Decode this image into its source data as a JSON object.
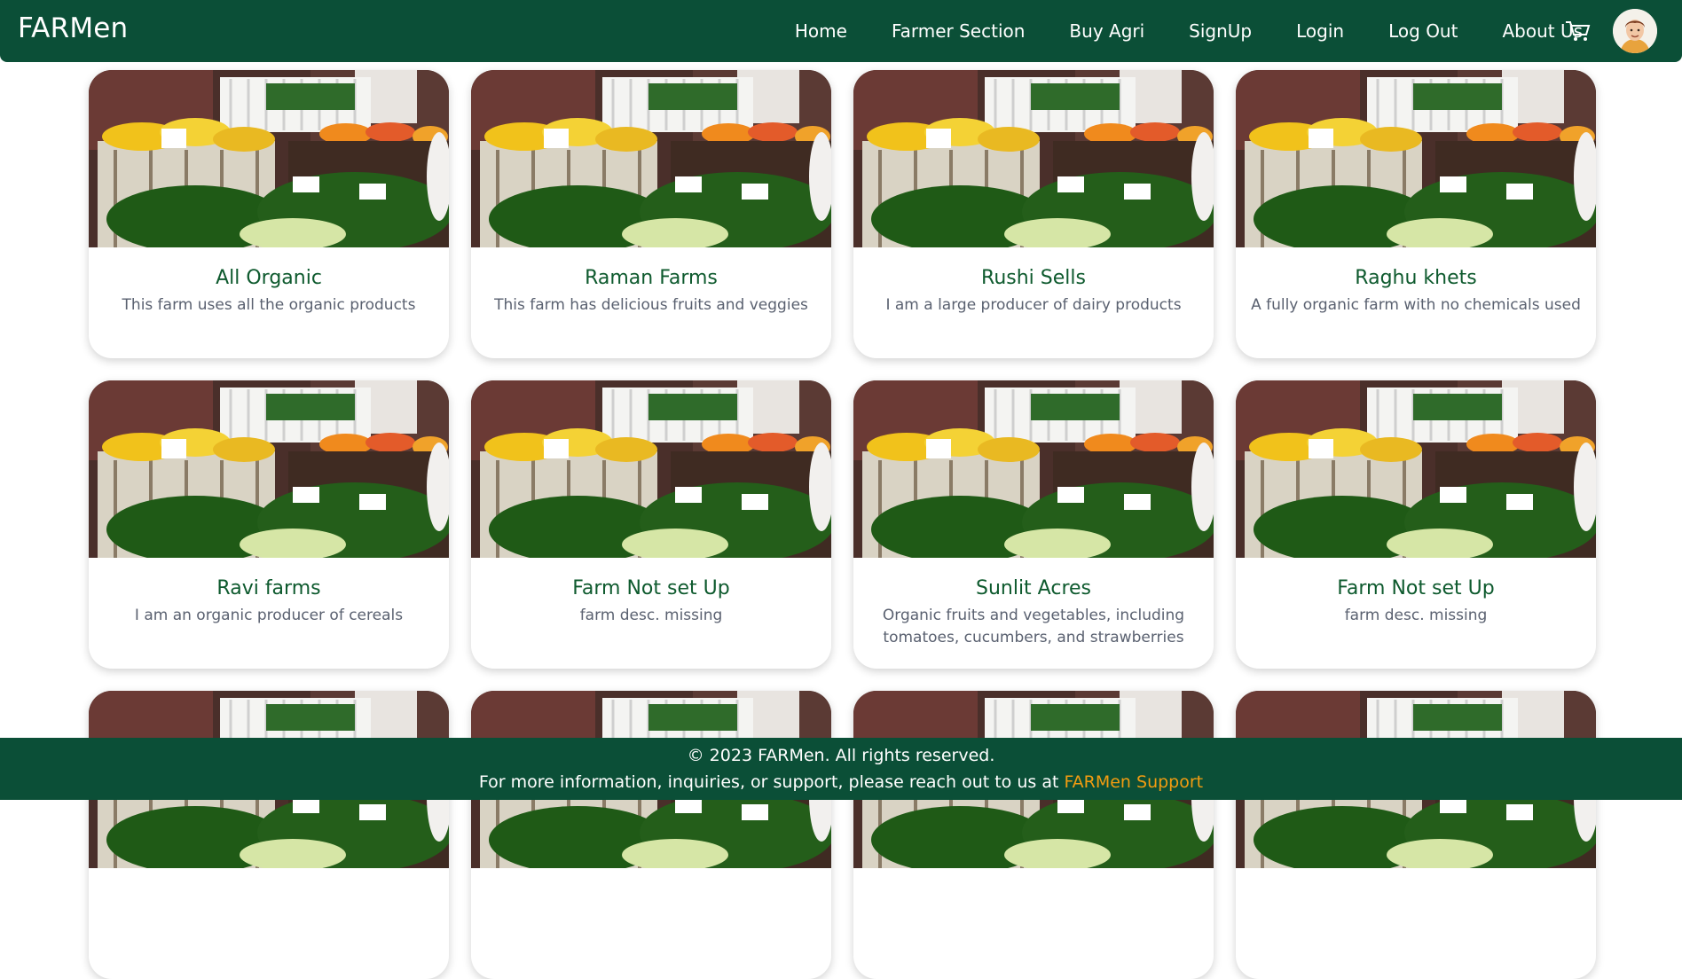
{
  "navbar": {
    "brand": "FARMen",
    "links": [
      "Home",
      "Farmer Section",
      "Buy Agri",
      "SignUp",
      "Login",
      "Log Out",
      "About Us"
    ]
  },
  "farms": [
    {
      "title": "All Organic",
      "desc": "This farm uses all the organic products"
    },
    {
      "title": "Raman Farms",
      "desc": "This farm has delicious fruits and veggies"
    },
    {
      "title": "Rushi Sells",
      "desc": "I am a large producer of dairy products"
    },
    {
      "title": "Raghu khets",
      "desc": "A fully organic farm with no chemicals used"
    },
    {
      "title": "Ravi farms",
      "desc": "I am an organic producer of cereals"
    },
    {
      "title": "Farm Not set Up",
      "desc": "farm desc. missing"
    },
    {
      "title": "Sunlit Acres",
      "desc": "Organic fruits and vegetables, including tomatoes, cucumbers, and strawberries"
    },
    {
      "title": "Farm Not set Up",
      "desc": "farm desc. missing"
    },
    {
      "title": "",
      "desc": ""
    },
    {
      "title": "",
      "desc": ""
    },
    {
      "title": "",
      "desc": ""
    },
    {
      "title": "",
      "desc": ""
    }
  ],
  "footer": {
    "copyright": "© 2023 FARMen. All rights reserved.",
    "contact_text": "For more information, inquiries, or support, please reach out to us at ",
    "contact_link": "FARMen Support"
  },
  "colors": {
    "primary": "#0b4f37",
    "accent": "#f29c11",
    "title": "#0e5a2e"
  },
  "icons": {
    "cart": "cart-icon",
    "avatar": "user-avatar"
  }
}
